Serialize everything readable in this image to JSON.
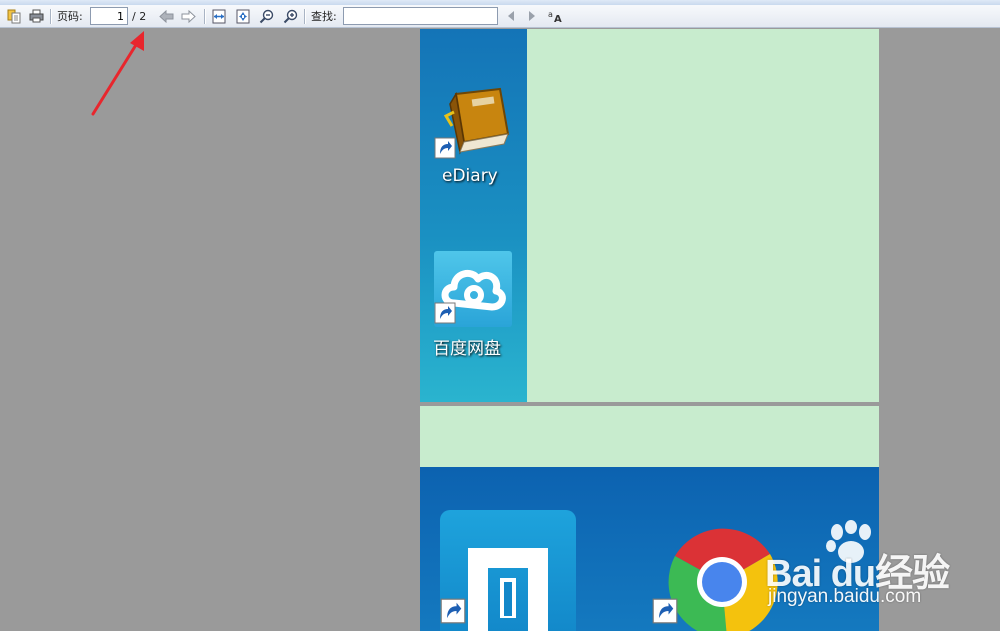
{
  "toolbar": {
    "page_label": "页码:",
    "page_value": "1",
    "page_total": "/ 2",
    "find_label": "查找:",
    "find_value": "",
    "icons": [
      "open-icon",
      "print-icon",
      "prev-page-icon",
      "next-page-icon",
      "fit-width-icon",
      "fit-page-icon",
      "zoom-out-icon",
      "zoom-in-icon",
      "find-prev-icon",
      "find-next-icon",
      "match-case-icon"
    ]
  },
  "document": {
    "pages": [
      {
        "desktop_icons": [
          {
            "label": "eDiary",
            "icon": "ediary-book-icon"
          },
          {
            "label": "百度网盘",
            "icon": "baidu-netdisk-icon"
          }
        ]
      },
      {
        "desktop_icons": [
          {
            "icon": "maxthon-browser-icon"
          },
          {
            "icon": "chrome-icon"
          }
        ]
      }
    ]
  },
  "annotation": {
    "type": "red-arrow",
    "target": "page-total",
    "color": "#e8262d"
  },
  "watermark": {
    "brand": "Bai du经验",
    "url": "jingyan.baidu.com"
  },
  "colors": {
    "page_background": "#c8ecce",
    "viewer_background": "#9a9a9a",
    "desktop_blue": "#1474b7"
  }
}
